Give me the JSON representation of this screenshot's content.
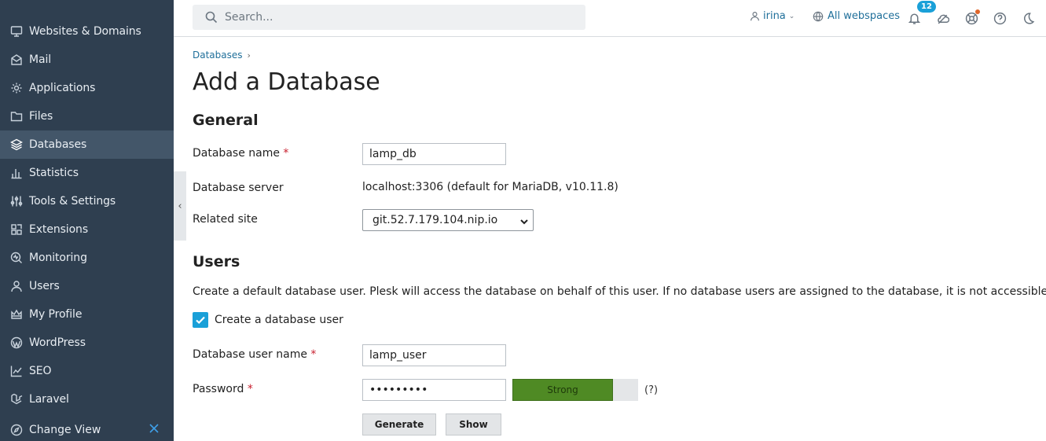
{
  "sidebar": {
    "items": [
      {
        "label": "Websites & Domains",
        "icon": "monitor-icon"
      },
      {
        "label": "Mail",
        "icon": "mail-icon"
      },
      {
        "label": "Applications",
        "icon": "gear-icon"
      },
      {
        "label": "Files",
        "icon": "folder-icon"
      },
      {
        "label": "Databases",
        "icon": "layers-icon",
        "active": true
      },
      {
        "label": "Statistics",
        "icon": "bar-chart-icon"
      },
      {
        "label": "Tools & Settings",
        "icon": "sliders-icon"
      },
      {
        "label": "Extensions",
        "icon": "grid-icon"
      },
      {
        "label": "Monitoring",
        "icon": "monitoring-icon"
      },
      {
        "label": "Users",
        "icon": "user-icon"
      },
      {
        "label": "My Profile",
        "icon": "crown-icon"
      },
      {
        "label": "WordPress",
        "icon": "wordpress-icon"
      },
      {
        "label": "SEO",
        "icon": "seo-chart-icon"
      },
      {
        "label": "Laravel",
        "icon": "laravel-icon"
      }
    ],
    "change_view": "Change View"
  },
  "topbar": {
    "search_placeholder": "Search...",
    "user": "irina",
    "webspaces": "All webspaces",
    "notifications_count": "12"
  },
  "breadcrumb": {
    "item": "Databases",
    "separator": "›"
  },
  "page": {
    "title": "Add a Database",
    "general_heading": "General",
    "db_name_label": "Database name",
    "db_name_value": "lamp_db",
    "db_server_label": "Database server",
    "db_server_value": "localhost:3306 (default for MariaDB, v10.11.8)",
    "related_site_label": "Related site",
    "related_site_value": "git.52.7.179.104.nip.io",
    "users_heading": "Users",
    "users_desc": "Create a default database user. Plesk will access the database on behalf of this user. If no database users are assigned to the database, it is not accessible.",
    "create_user_label": "Create a database user",
    "db_user_label": "Database user name",
    "db_user_value": "lamp_user",
    "password_label": "Password",
    "password_value": "•••••••••",
    "strength_label": "Strength",
    "strength_text": "Strong",
    "strength_fraction": 0.8,
    "help_text": "(?)",
    "generate_button": "Generate",
    "show_button": "Show",
    "required_mark": "*"
  },
  "colors": {
    "sidebar_bg": "#2f3f50",
    "accent": "#1aa0d8",
    "link": "#1f6f9a",
    "strength_fill": "#4f8a24"
  }
}
